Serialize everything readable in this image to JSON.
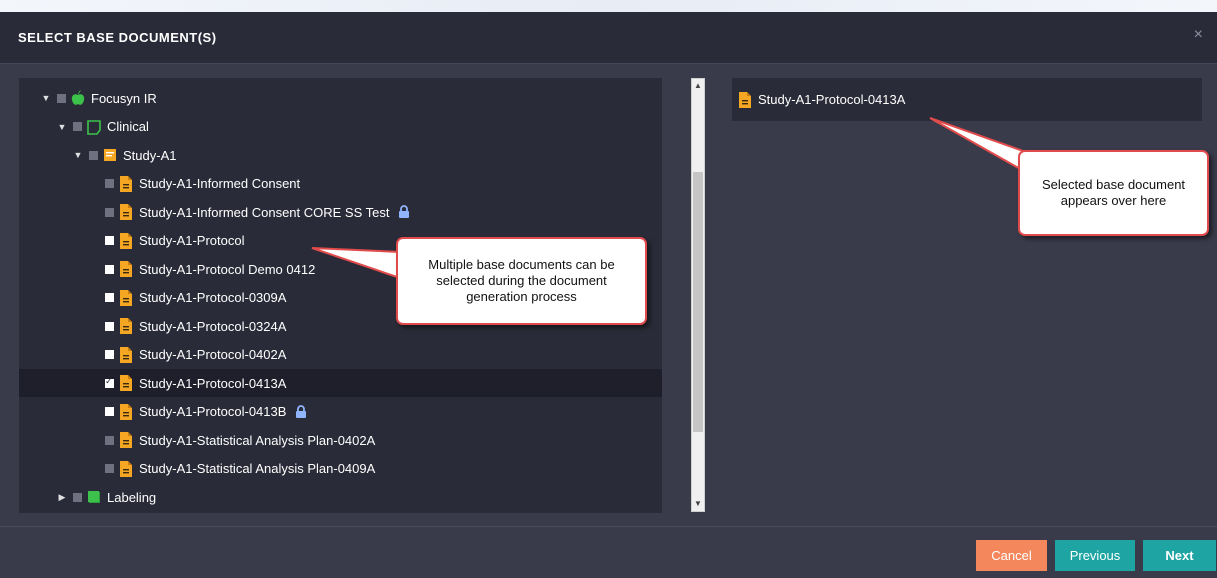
{
  "dialog": {
    "title": "SELECT BASE DOCUMENT(S)",
    "close_glyph": "×"
  },
  "tree": [
    {
      "label": "Focusyn IR",
      "icon": "apple-icon",
      "expanded": true,
      "check": "gray",
      "level": 0
    },
    {
      "label": "Clinical",
      "icon": "folder-outline-icon",
      "expanded": true,
      "check": "gray",
      "level": 1
    },
    {
      "label": "Study-A1",
      "icon": "study-folder-icon",
      "expanded": true,
      "check": "gray",
      "level": 2
    },
    {
      "label": "Study-A1-Informed Consent",
      "icon": "document-icon",
      "check": "gray",
      "level": 3
    },
    {
      "label": "Study-A1-Informed Consent CORE SS Test",
      "icon": "document-icon",
      "check": "gray",
      "level": 3,
      "locked": true
    },
    {
      "label": "Study-A1-Protocol",
      "icon": "document-icon",
      "check": "white",
      "level": 3
    },
    {
      "label": "Study-A1-Protocol Demo 0412",
      "icon": "document-icon",
      "check": "white",
      "level": 3
    },
    {
      "label": "Study-A1-Protocol-0309A",
      "icon": "document-icon",
      "check": "white",
      "level": 3
    },
    {
      "label": "Study-A1-Protocol-0324A",
      "icon": "document-icon",
      "check": "white",
      "level": 3
    },
    {
      "label": "Study-A1-Protocol-0402A",
      "icon": "document-icon",
      "check": "white",
      "level": 3
    },
    {
      "label": "Study-A1-Protocol-0413A",
      "icon": "document-icon",
      "check": "checked",
      "level": 3,
      "selected": true
    },
    {
      "label": "Study-A1-Protocol-0413B",
      "icon": "document-icon",
      "check": "white",
      "level": 3,
      "locked": true
    },
    {
      "label": "Study-A1-Statistical Analysis Plan-0402A",
      "icon": "document-icon",
      "check": "gray",
      "level": 3
    },
    {
      "label": "Study-A1-Statistical Analysis Plan-0409A",
      "icon": "document-icon",
      "check": "gray",
      "level": 3
    },
    {
      "label": "Labeling",
      "icon": "labeling-icon",
      "expanded": false,
      "check": "gray",
      "level": 1
    }
  ],
  "selected_panel": {
    "label": "Study-A1-Protocol-0413A"
  },
  "callouts": {
    "left": "Multiple base documents can be selected during the document generation process",
    "right": "Selected base document appears over here"
  },
  "buttons": {
    "cancel": "Cancel",
    "previous": "Previous",
    "next": "Next"
  },
  "colors": {
    "accent_teal": "#1fa4a4",
    "cancel_orange": "#f4875b",
    "doc_icon": "#f5a623",
    "green_icon": "#3cc24a",
    "callout_border": "#e14b4b"
  }
}
